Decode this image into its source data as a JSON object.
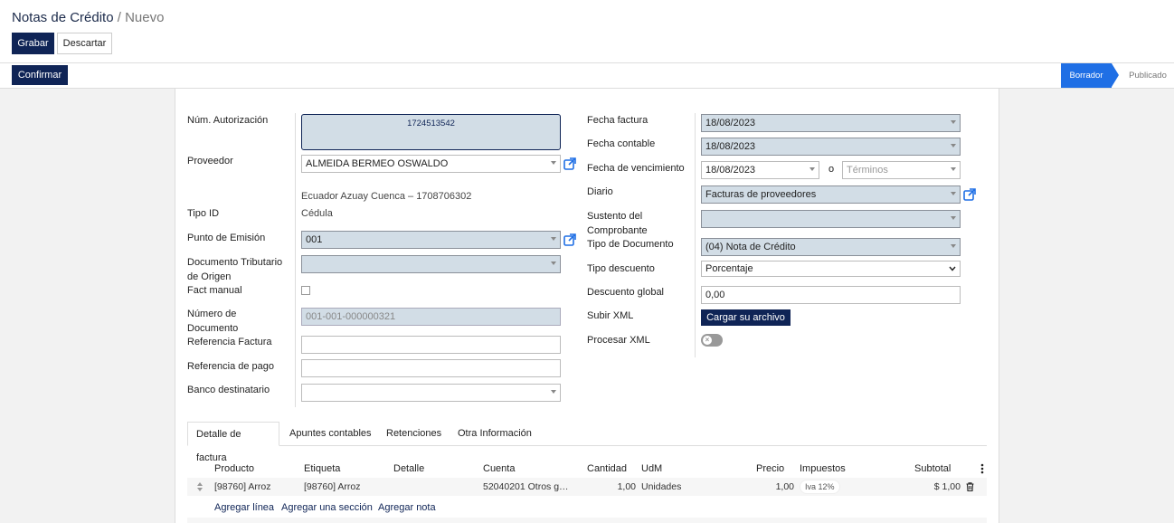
{
  "header": {
    "breadcrumb_current": "Notas de Crédito",
    "breadcrumb_sep": "/",
    "breadcrumb_new": "Nuevo",
    "save_label": "Grabar",
    "discard_label": "Descartar",
    "confirm_label": "Confirmar"
  },
  "statusbar": {
    "stages": [
      "Borrador",
      "Publicado"
    ],
    "active": "Borrador"
  },
  "left": {
    "num_autorizacion": {
      "label": "Núm. Autorización",
      "value": "1724513542"
    },
    "proveedor": {
      "label": "Proveedor",
      "value": "ALMEIDA BERMEO OSWALDO",
      "address": "Ecuador Azuay Cuenca – 1708706302"
    },
    "tipo_id": {
      "label": "Tipo ID",
      "value": "Cédula"
    },
    "punto_emision": {
      "label": "Punto de Emisión",
      "value": "001"
    },
    "doc_tributario": {
      "label": "Documento Tributario de Origen",
      "value": ""
    },
    "fact_manual": {
      "label": "Fact manual",
      "checked": false
    },
    "numero_documento": {
      "label": "Número de Documento",
      "value": "001-001-000000321"
    },
    "referencia_factura": {
      "label": "Referencia Factura",
      "value": ""
    },
    "referencia_pago": {
      "label": "Referencia de pago",
      "value": ""
    },
    "banco_destinatario": {
      "label": "Banco destinatario",
      "value": ""
    }
  },
  "right": {
    "fecha_factura": {
      "label": "Fecha factura",
      "value": "18/08/2023"
    },
    "fecha_contable": {
      "label": "Fecha contable",
      "value": "18/08/2023"
    },
    "fecha_vencimiento": {
      "label": "Fecha de vencimiento",
      "value": "18/08/2023",
      "or": "o",
      "terminos_placeholder": "Términos"
    },
    "diario": {
      "label": "Diario",
      "value": "Facturas de proveedores"
    },
    "sustento": {
      "label": "Sustento del Comprobante",
      "value": ""
    },
    "tipo_documento": {
      "label": "Tipo de Documento",
      "value": "(04) Nota de  Crédito"
    },
    "tipo_descuento": {
      "label": "Tipo descuento",
      "value": "Porcentaje"
    },
    "descuento_global": {
      "label": "Descuento global",
      "value": "0,00"
    },
    "subir_xml": {
      "label": "Subir XML",
      "button": "Cargar su archivo"
    },
    "procesar_xml": {
      "label": "Procesar XML",
      "enabled": false
    }
  },
  "tabs": [
    "Detalle de factura",
    "Apuntes contables",
    "Retenciones",
    "Otra Información"
  ],
  "active_tab": "Detalle de factura",
  "lines_table": {
    "columns": [
      "Producto",
      "Etiqueta",
      "Detalle",
      "Cuenta",
      "Cantidad",
      "UdM",
      "Precio",
      "Impuestos",
      "Subtotal"
    ],
    "rows": [
      {
        "producto": "[98760] Arroz",
        "etiqueta": "[98760] Arroz",
        "detalle": "",
        "cuenta": "52040201 Otros g…",
        "cantidad": "1,00",
        "udm": "Unidades",
        "precio": "1,00",
        "impuestos": "Iva 12%",
        "subtotal": "$ 1,00"
      }
    ],
    "actions": [
      "Agregar línea",
      "Agregar una sección",
      "Agregar nota"
    ]
  },
  "colors": {
    "primary": "#0f2456",
    "accent": "#1f6fe5",
    "required_bg": "#d2dde6"
  },
  "icons": [
    "external-link-icon",
    "caret-down-icon",
    "trash-icon",
    "drag-handle-icon",
    "kebab-icon"
  ]
}
